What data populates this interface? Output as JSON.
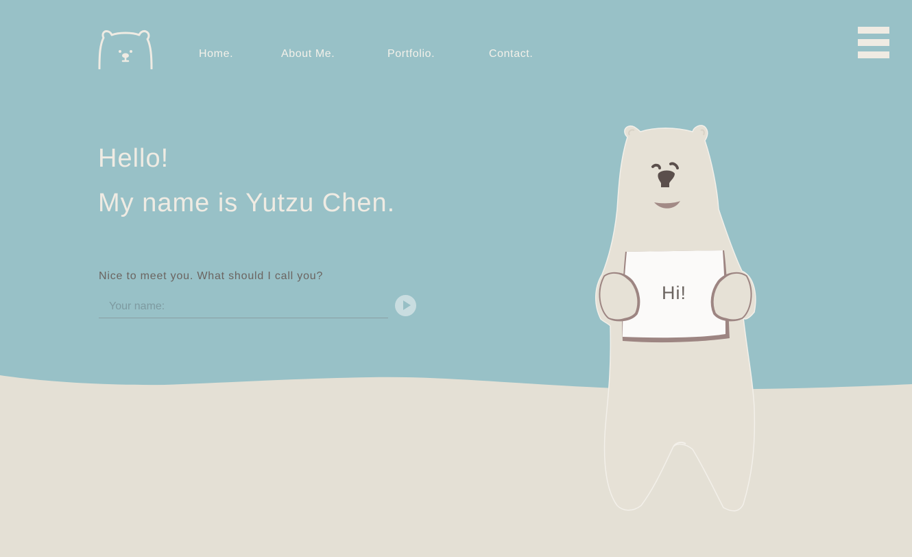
{
  "colors": {
    "sky": "#98c1c7",
    "ground": "#e4e0d5",
    "text_light": "#efebe3",
    "text_dark": "#6b6460",
    "bear_fur": "#e6e1d6",
    "sign_edge": "#9d8582"
  },
  "header": {
    "logo_icon": "bear-head-icon",
    "nav": [
      {
        "label": "Home."
      },
      {
        "label": "About Me."
      },
      {
        "label": "Portfolio."
      },
      {
        "label": "Contact."
      }
    ],
    "menu_icon": "hamburger-menu-icon"
  },
  "hero": {
    "greeting": "Hello!",
    "intro": "My name is Yutzu Chen."
  },
  "form": {
    "question": "Nice to meet you. What should I call you?",
    "input_value": "",
    "input_placeholder": "Your name:",
    "submit_icon": "play-arrow-icon"
  },
  "illustration": {
    "sign_text": "Hi!",
    "icon": "polar-bear-illustration"
  }
}
